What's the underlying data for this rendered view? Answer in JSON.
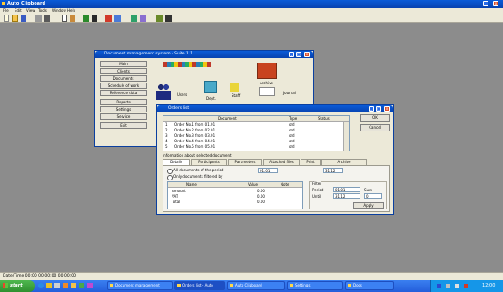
{
  "app": {
    "title": "Auto Clipboard",
    "menu": [
      "File",
      "Edit",
      "View",
      "Tools",
      "Window",
      "Help"
    ],
    "toolbar_icons": [
      "new-icon",
      "open-icon",
      "save-icon",
      "print-icon",
      "cut-icon",
      "copy-icon",
      "paste-icon",
      "undo-icon",
      "find-icon",
      "chart-icon",
      "calendar-icon",
      "help-icon",
      "image-icon",
      "table-icon",
      "close-doc-icon"
    ],
    "status_text": "Date/Time 00:00 00:00:00 00:00:00"
  },
  "launcher": {
    "title": "Document management system - Suite 1.1",
    "nav": [
      "Main",
      "Clients",
      "Documents",
      "Schedule of work",
      "Reference data",
      "Reports",
      "Settings",
      "Service",
      "Exit"
    ],
    "tiles": [
      "Users",
      "Dept.",
      "Staff",
      "Archive",
      "Journal"
    ]
  },
  "dialog": {
    "title": "Orders list",
    "ok_label": "OK",
    "cancel_label": "Cancel",
    "columns": [
      "Document",
      "Type",
      "Status"
    ],
    "rows": [
      {
        "num": "1",
        "doc": "Order No.1 from 01.01",
        "type": "ord",
        "status": ""
      },
      {
        "num": "2",
        "doc": "Order No.2 from 02.01",
        "type": "ord",
        "status": ""
      },
      {
        "num": "3",
        "doc": "Order No.3 from 03.01",
        "type": "ord",
        "status": ""
      },
      {
        "num": "4",
        "doc": "Order No.4 from 04.01",
        "type": "ord",
        "status": ""
      },
      {
        "num": "5",
        "doc": "Order No.5 from 05.01",
        "type": "ord",
        "status": ""
      }
    ],
    "group_caption": "Information about selected document",
    "tabs": [
      "Details",
      "Participants",
      "Parameters",
      "Attached files",
      "Print",
      "Archive"
    ],
    "radio1": "All documents of the period",
    "radio2": "Only documents filtered by",
    "date_from": "01.01",
    "date_to": "31.12",
    "subtable": {
      "headers": [
        "Name",
        "Value",
        "Note"
      ],
      "rows": [
        {
          "name": "Amount",
          "value": "0.00",
          "note": ""
        },
        {
          "name": "VAT",
          "value": "0.00",
          "note": ""
        },
        {
          "name": "Total",
          "value": "0.00",
          "note": ""
        }
      ]
    },
    "side": {
      "caption": "Filter",
      "f1_label": "Period",
      "f1_value": "01.01",
      "f2_label": "Until",
      "f2_value": "31.12",
      "f3_label": "Sum",
      "f3_value": "0",
      "apply_label": "Apply"
    }
  },
  "taskbar": {
    "start_label": "start",
    "tasks": [
      "Document management",
      "Orders list - Auto",
      "Auto Clipboard",
      "Settings",
      "Docs"
    ],
    "tray_time": "12:00"
  }
}
